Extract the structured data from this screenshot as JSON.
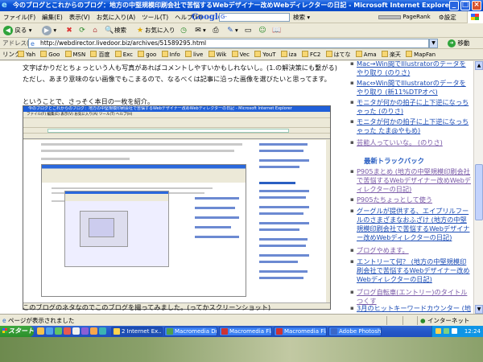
{
  "window": {
    "title": "今のブログとこれからのブログ：地方の中堅規模印刷会社で苦悩するWebデザイナー改めWebディレクターの日記 - Microsoft Internet Explorer",
    "minimize": "_",
    "maximize": "□",
    "close": "×"
  },
  "menu": {
    "items": [
      "ファイル(F)",
      "編集(E)",
      "表示(V)",
      "お気に入り(A)",
      "ツール(T)",
      "ヘルプ(H)"
    ],
    "google_logo": "Google",
    "google_g": "G-",
    "search_label": "検索",
    "pagerank_label": "PageRank",
    "settings_label": "設定"
  },
  "toolbar": {
    "back_label": "戻る",
    "search_label": "検索",
    "favorites_label": "お気に入り"
  },
  "address": {
    "label": "アドレス(D)",
    "url": "http://webdirector.livedoor.biz/archives/51589295.html",
    "go_label": "移動"
  },
  "links": {
    "label": "リンク",
    "items": [
      "Yah",
      "Goo",
      "MSN",
      "百度",
      "Exc",
      "goo",
      "Info",
      "live",
      "Wik",
      "Vec",
      "YouT",
      "iza",
      "FC2",
      "はてな",
      "Ama",
      "楽天",
      "MapFan"
    ]
  },
  "article": {
    "line1": "文字ばかりだとちょっという人も写真があればコメントしやすいかもしれないし。(1.の解決策にも繋がる)",
    "line2": "ただし、あまり意味のない画像でもこまるので、なるべくは記事に沿った画像を選びたいと思ってます。",
    "line3": "ということで、さっそく本日の一枚を紹介。",
    "caption": "このブログのネタなのでこのブログを撮ってみました。(ってかスクリーンショット)"
  },
  "embedded": {
    "title": "今のブログとこれからのブログ：地方の中堅規模印刷会社で苦悩するWebデザイナー改めWebディレクターの日記 - Microsoft Internet Explorer",
    "menu": "ファイル(F) 編集(E) 表示(V) お気に入り(A) ツール(T) ヘルプ(H)"
  },
  "sidebar": {
    "items_top": [
      {
        "text": "Mac→Win間でIllustratorのデータをやり取り (のりさ)"
      },
      {
        "text": "Mac⇔Win間でIllustratorのデータをやり取り (新11%DTPオペ)"
      },
      {
        "text": "モニタが何かの拍子に上下逆になっちゃった (のりさ)"
      },
      {
        "text": "モニタが何かの拍子に上下逆になっちゃった たま@やもめ)"
      },
      {
        "text": "芸能人っていいな。 (のりさ)"
      }
    ],
    "trackback_heading": "最新トラックバック",
    "trackbacks": [
      {
        "text": "P905まとめ (地方の中堅規模印刷会社で苦悩するWebデザイナー改めWebディレクターの日記)"
      },
      {
        "text": "P905たちょっとして使う"
      },
      {
        "text": "グーグルが提供する、エイプリルフールのさまざまなおふざけ (地方の中堅規模印刷会社で苦悩するWebデザイナー改めWebディレクターの日記)"
      },
      {
        "text": "ブログやめます。"
      },
      {
        "text": "エントリーて何？ (地方の中堅規模印刷会社で苦悩するWebデザイナー改めWebディレクターの日記)"
      },
      {
        "text": "ブログ自転車(エントリー)のタイトルつくす"
      },
      {
        "text": "3月のヒットキーワードカウンター (地方の中堅規模印刷会社で苦悩するWebデザイナー改めWebディレクターの日記)"
      }
    ]
  },
  "status": {
    "text": "ページが表示されました",
    "zone": "インターネット"
  },
  "taskbar": {
    "start": "スタート",
    "tasks": [
      "2 Internet Ex...",
      "Macromedia Dre...",
      "Macromedia Fla...",
      "Macromedia Fla...",
      "Adobe Photoshop"
    ],
    "clock": "12:24"
  }
}
